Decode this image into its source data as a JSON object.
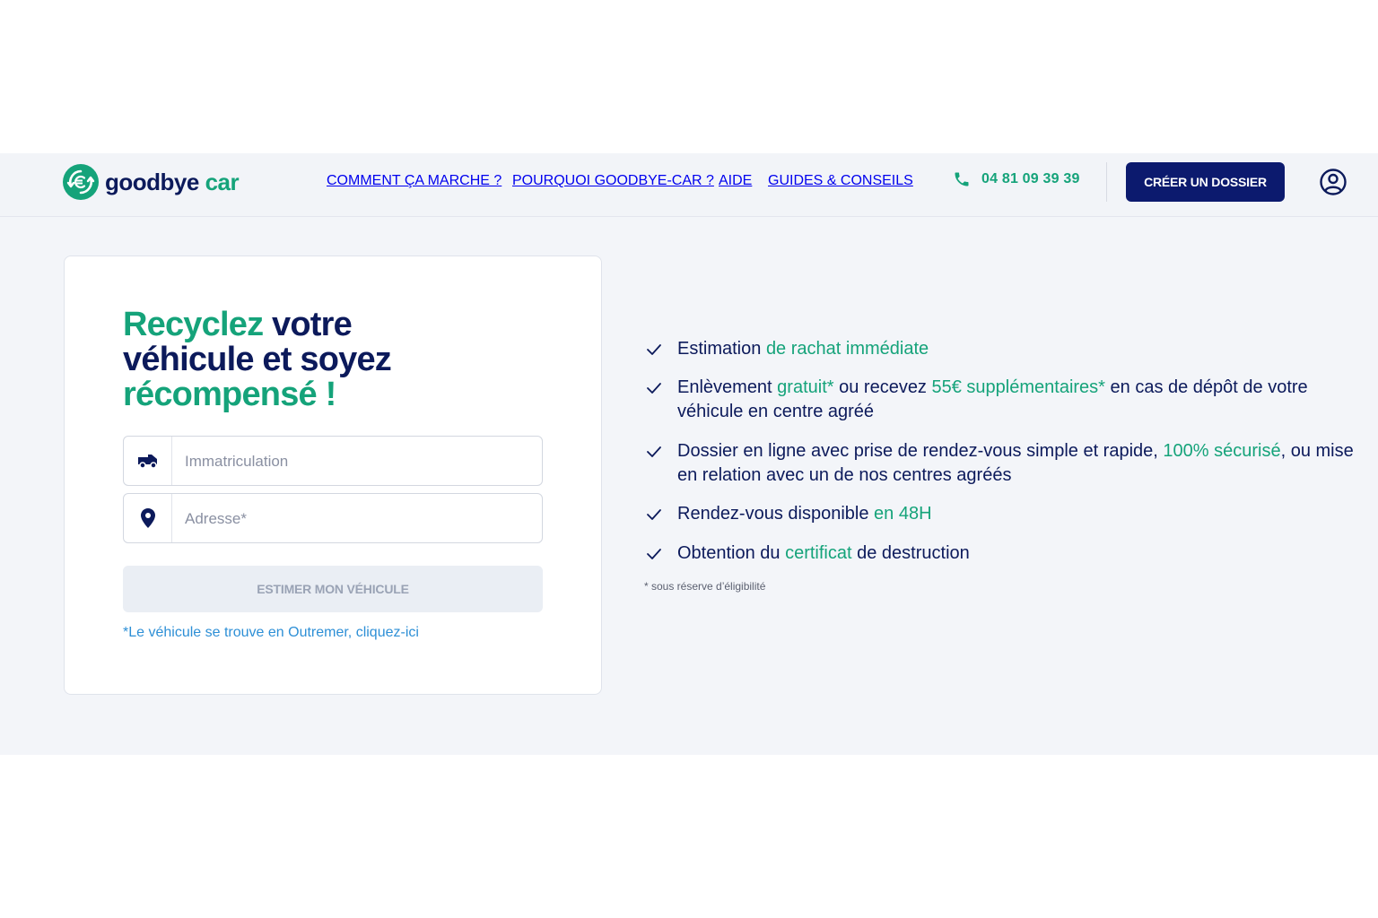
{
  "brand": {
    "name_part1": "goodbye",
    "name_part2": "car",
    "icon": "euro-recycle-icon",
    "colors": {
      "navy": "#0c1a5b",
      "green": "#15a37a",
      "blue_link": "#2d8fd6"
    }
  },
  "nav": {
    "items": [
      {
        "label": "COMMENT ÇA MARCHE ?"
      },
      {
        "label": "POURQUOI GOODBYE-CAR ?"
      },
      {
        "label": "AIDE"
      },
      {
        "label": "GUIDES & CONSEILS"
      }
    ]
  },
  "header": {
    "phone": "04 81 09 39 39",
    "cta_label": "CRÉER UN DOSSIER",
    "account_icon": "user-circle-icon"
  },
  "hero": {
    "title_green_1": "Recyclez",
    "title_navy": " votre véhicule et soyez ",
    "title_green_2": "récompensé !"
  },
  "form": {
    "plate_placeholder": "Immatriculation",
    "plate_icon": "car-icon",
    "address_placeholder": "Adresse*",
    "address_icon": "location-pin-icon",
    "submit_label": "ESTIMER MON VÉHICULE",
    "outremer_link": "*Le véhicule se trouve en Outremer, cliquez-ici"
  },
  "benefits": [
    {
      "a": "Estimation ",
      "b": "de rachat immédiate",
      "c": "",
      "d": "",
      "e": ""
    },
    {
      "a": "Enlèvement ",
      "b": "gratuit*",
      "c": " ou recevez ",
      "d": "55€ supplémentaires*",
      "e": " en cas de dépôt de votre véhicule en centre agréé"
    },
    {
      "a": "Dossier en ligne avec prise de rendez-vous simple et rapide, ",
      "b": "100% sécurisé",
      "c": ", ou mise en relation avec un de nos centres agréés",
      "d": "",
      "e": ""
    },
    {
      "a": "Rendez-vous disponible ",
      "b": "en 48H",
      "c": "",
      "d": "",
      "e": ""
    },
    {
      "a": "Obtention du ",
      "b": "certificat",
      "c": " de destruction",
      "d": "",
      "e": ""
    }
  ],
  "footnote": "* sous réserve d’éligibilité"
}
